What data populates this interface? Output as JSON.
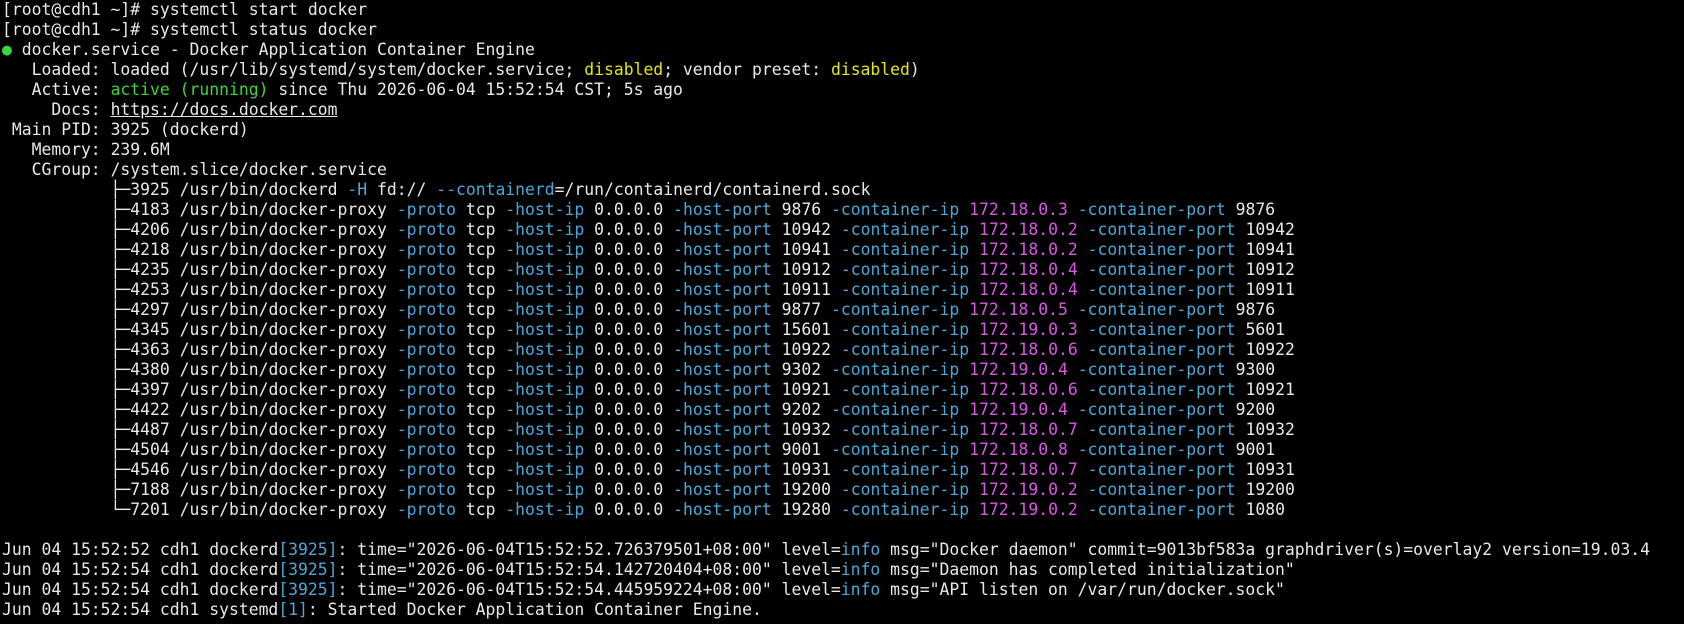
{
  "colors": {
    "background": "#000000",
    "text": "#e8e8e8",
    "active_green": "#3fd43f",
    "disabled_yellow": "#e5e510",
    "flag_blue": "#4aa8d8",
    "ip_magenta": "#d957e3"
  },
  "prompt": "[root@cdh1 ~]# ",
  "commands": [
    "systemctl start docker",
    "systemctl status docker"
  ],
  "status": {
    "bullet": "●",
    "header": " docker.service - Docker Application Container Engine",
    "loaded_label": "   Loaded: ",
    "loaded_pre": "loaded (/usr/lib/systemd/system/docker.service; ",
    "loaded_disabled": "disabled",
    "loaded_mid": "; vendor preset: ",
    "loaded_preset": "disabled",
    "loaded_post": ")",
    "active_label": "   Active: ",
    "active_state": "active (running)",
    "active_since": " since Thu 2026-06-04 15:52:54 CST; 5s ago",
    "docs_label": "     Docs: ",
    "docs_url": "https://docs.docker.com",
    "pid_label": " Main PID: ",
    "pid_value": "3925 (dockerd)",
    "memory_label": "   Memory: ",
    "memory_value": "239.6M",
    "cgroup_label": "   CGroup: ",
    "cgroup_value": "/system.slice/docker.service"
  },
  "dockerd_line": {
    "tree": "           ├─",
    "pid": "3925",
    "cmd": " /usr/bin/dockerd ",
    "flag_h": "-H",
    "fd": " fd:// ",
    "flag_containerd": "--containerd",
    "sock": "=/run/containerd/containerd.sock"
  },
  "proxy_labels": {
    "cmd": " /usr/bin/docker-proxy ",
    "proto_flag": "-proto",
    "proto_value": " tcp ",
    "host_ip_flag": "-host-ip",
    "host_ip_value": " 0.0.0.0 ",
    "host_port_flag": "-host-port",
    "container_ip_flag": "-container-ip",
    "container_port_flag": "-container-port"
  },
  "proxies": [
    {
      "tree": "           ├─",
      "pid": "4183",
      "host_port": "9876",
      "container_ip": "172.18.0.3",
      "container_port": "9876"
    },
    {
      "tree": "           ├─",
      "pid": "4206",
      "host_port": "10942",
      "container_ip": "172.18.0.2",
      "container_port": "10942"
    },
    {
      "tree": "           ├─",
      "pid": "4218",
      "host_port": "10941",
      "container_ip": "172.18.0.2",
      "container_port": "10941"
    },
    {
      "tree": "           ├─",
      "pid": "4235",
      "host_port": "10912",
      "container_ip": "172.18.0.4",
      "container_port": "10912"
    },
    {
      "tree": "           ├─",
      "pid": "4253",
      "host_port": "10911",
      "container_ip": "172.18.0.4",
      "container_port": "10911"
    },
    {
      "tree": "           ├─",
      "pid": "4297",
      "host_port": "9877",
      "container_ip": "172.18.0.5",
      "container_port": "9876"
    },
    {
      "tree": "           ├─",
      "pid": "4345",
      "host_port": "15601",
      "container_ip": "172.19.0.3",
      "container_port": "5601"
    },
    {
      "tree": "           ├─",
      "pid": "4363",
      "host_port": "10922",
      "container_ip": "172.18.0.6",
      "container_port": "10922"
    },
    {
      "tree": "           ├─",
      "pid": "4380",
      "host_port": "9302",
      "container_ip": "172.19.0.4",
      "container_port": "9300"
    },
    {
      "tree": "           ├─",
      "pid": "4397",
      "host_port": "10921",
      "container_ip": "172.18.0.6",
      "container_port": "10921"
    },
    {
      "tree": "           ├─",
      "pid": "4422",
      "host_port": "9202",
      "container_ip": "172.19.0.4",
      "container_port": "9200"
    },
    {
      "tree": "           ├─",
      "pid": "4487",
      "host_port": "10932",
      "container_ip": "172.18.0.7",
      "container_port": "10932"
    },
    {
      "tree": "           ├─",
      "pid": "4504",
      "host_port": "9001",
      "container_ip": "172.18.0.8",
      "container_port": "9001"
    },
    {
      "tree": "           ├─",
      "pid": "4546",
      "host_port": "10931",
      "container_ip": "172.18.0.7",
      "container_port": "10931"
    },
    {
      "tree": "           ├─",
      "pid": "7188",
      "host_port": "19200",
      "container_ip": "172.19.0.2",
      "container_port": "19200"
    },
    {
      "tree": "           └─",
      "pid": "7201",
      "host_port": "19280",
      "container_ip": "172.19.0.2",
      "container_port": "1080"
    }
  ],
  "logs": [
    {
      "date": "Jun 04 15:52:52 cdh1 dockerd",
      "pid": "[3925]",
      "pre": ": time=\"2026-06-04T15:52:52.726379501+08:00\" level=",
      "level": "info",
      "post": " msg=\"Docker daemon\" commit=9013bf583a graphdriver(s)=overlay2 version=19.03.4"
    },
    {
      "date": "Jun 04 15:52:54 cdh1 dockerd",
      "pid": "[3925]",
      "pre": ": time=\"2026-06-04T15:52:54.142720404+08:00\" level=",
      "level": "info",
      "post": " msg=\"Daemon has completed initialization\""
    },
    {
      "date": "Jun 04 15:52:54 cdh1 dockerd",
      "pid": "[3925]",
      "pre": ": time=\"2026-06-04T15:52:54.445959224+08:00\" level=",
      "level": "info",
      "post": " msg=\"API listen on /var/run/docker.sock\""
    },
    {
      "date": "Jun 04 15:52:54 cdh1 systemd",
      "pid": "[1]",
      "pre": ": Started Docker Application Container Engine.",
      "level": "",
      "post": ""
    }
  ]
}
